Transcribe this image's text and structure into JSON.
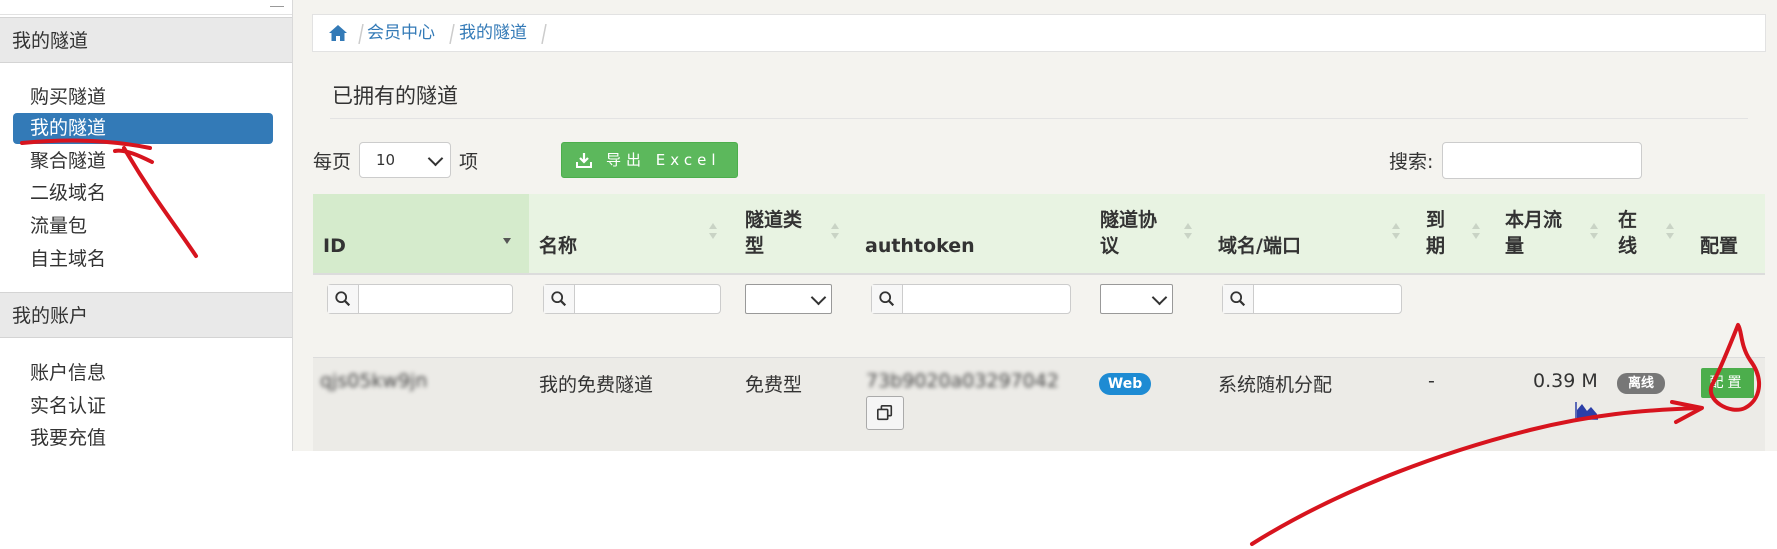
{
  "sidebar": {
    "section_tunnels": "我的隧道",
    "tunnel_items": [
      {
        "label": "购买隧道"
      },
      {
        "label": "我的隧道",
        "active": true
      },
      {
        "label": "聚合隧道"
      },
      {
        "label": "二级域名"
      },
      {
        "label": "流量包"
      },
      {
        "label": "自主域名"
      }
    ],
    "section_account": "我的账户",
    "account_items": [
      {
        "label": "账户信息"
      },
      {
        "label": "实名认证"
      },
      {
        "label": "我要充值"
      }
    ]
  },
  "breadcrumb": {
    "home_icon": "home-icon",
    "items": [
      "会员中心",
      "我的隧道"
    ]
  },
  "page": {
    "title": "已拥有的隧道",
    "per_page_prefix": "每页",
    "per_page_value": "10",
    "per_page_suffix": "项",
    "export_button": "导出 Excel",
    "search_label": "搜索:"
  },
  "table": {
    "headers": {
      "id": "ID",
      "name": "名称",
      "type_line1": "隧道类",
      "type_line2": "型",
      "authtoken": "authtoken",
      "protocol_line1": "隧道协",
      "protocol_line2": "议",
      "domain": "域名/端口",
      "expire_line1": "到",
      "expire_line2": "期",
      "traffic_line1": "本月流",
      "traffic_line2": "量",
      "online_line1": "在",
      "online_line2": "线",
      "config": "配置"
    },
    "row": {
      "id": "qjs05kw9jn",
      "name": "我的免费隧道",
      "type": "免费型",
      "authtoken": "73b9020a03297042",
      "protocol": "Web",
      "domain": "系统随机分配",
      "expire": "-",
      "traffic": "0.39 M",
      "online": "离线",
      "config_button": "配置"
    }
  },
  "colors": {
    "accent_blue": "#337ab7",
    "export_green": "#5cb85c",
    "header_green": "#e8f3e2",
    "badge_web": "#1e8bd3",
    "badge_offline": "#777777",
    "annotation_red": "#d7141e"
  }
}
